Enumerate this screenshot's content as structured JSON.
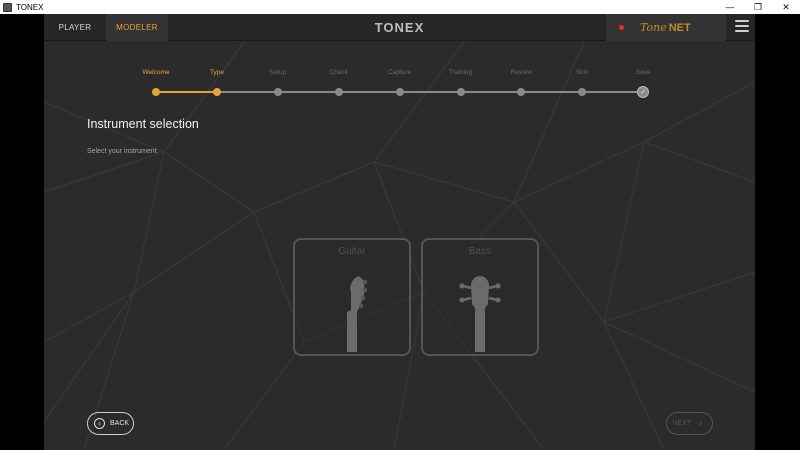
{
  "window": {
    "title": "TONEX",
    "minimize_glyph": "—",
    "maximize_glyph": "❐",
    "close_glyph": "✕"
  },
  "topbar": {
    "tabs": [
      {
        "label": "PLAYER",
        "active": false
      },
      {
        "label": "MODELER",
        "active": true
      }
    ],
    "brand": "TONEX",
    "tone_net_prefix": "Tone",
    "tone_net_suffix": "NET"
  },
  "stepper": {
    "steps": [
      {
        "label": "Welcome",
        "state": "done"
      },
      {
        "label": "Type",
        "state": "current"
      },
      {
        "label": "Setup",
        "state": "pending"
      },
      {
        "label": "Check",
        "state": "pending"
      },
      {
        "label": "Capture",
        "state": "pending"
      },
      {
        "label": "Training",
        "state": "pending"
      },
      {
        "label": "Review",
        "state": "pending"
      },
      {
        "label": "Skin",
        "state": "pending"
      },
      {
        "label": "Save",
        "state": "final"
      }
    ],
    "final_glyph": "✓"
  },
  "content": {
    "title": "Instrument selection",
    "subtitle": "Select your instrument."
  },
  "instruments": [
    {
      "label": "Guitar"
    },
    {
      "label": "Bass"
    }
  ],
  "nav": {
    "back_label": "BACK",
    "next_label": "NEXT",
    "back_glyph": "‹",
    "next_glyph": "›"
  },
  "colors": {
    "accent": "#e8a23a",
    "background": "#2b2b2b",
    "record": "#e23030"
  }
}
